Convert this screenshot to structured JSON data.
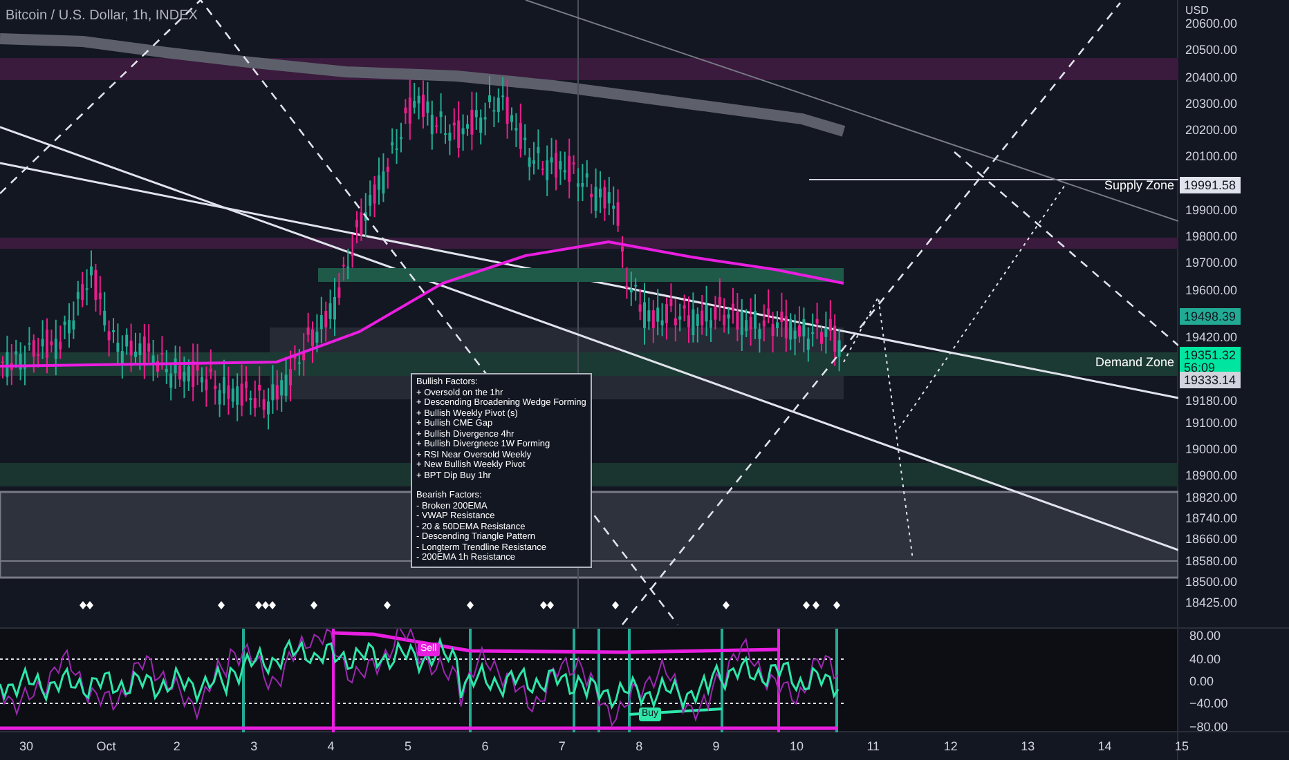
{
  "chart": {
    "title": "Bitcoin / U.S. Dollar, 1h, INDEX",
    "zones": [
      {
        "kind": "supply",
        "label": "Supply Zone"
      },
      {
        "kind": "demand",
        "label": "Demand Zone"
      }
    ],
    "note": {
      "bullish_title": "Bullish Factors:",
      "bullish": [
        "+ Oversold on the 1hr",
        "+ Descending Broadening Wedge Forming",
        "+ Bullish Weekly Pivot (s)",
        "+ Bullish CME Gap",
        "+ Bullish Divergence 4hr",
        "+ Bullish Divergnece 1W Forming",
        "+ RSI Near Oversold Weekly",
        "+ New Bullish Weekly Pivot",
        "+ BPT Dip Buy 1hr"
      ],
      "bearish_title": "Bearish Factors:",
      "bearish": [
        "- Broken 200EMA",
        "- VWAP Resistance",
        "- 20 & 50DEMA Resistance",
        "- Descending Triangle Pattern",
        "- Longterm Trendline Resistance",
        "- 200EMA 1h Resistance"
      ]
    }
  },
  "price_axis": {
    "currency": "USD",
    "labels": [
      "20600.00",
      "20500.00",
      "20400.00",
      "20300.00",
      "20200.00",
      "20100.00",
      "19900.00",
      "19800.00",
      "19700.00",
      "19600.00",
      "19420.00",
      "19180.00",
      "19100.00",
      "19000.00",
      "18900.00",
      "18820.00",
      "18740.00",
      "18660.00",
      "18580.00",
      "18500.00",
      "18425.00"
    ],
    "tags": [
      {
        "value": "19991.58",
        "color": "#e0e3eb"
      },
      {
        "value": "19498.39",
        "color": "#22ab94"
      },
      {
        "value": "19351.32",
        "countdown": "56:09",
        "color": "#00e6a0"
      },
      {
        "value": "19333.14",
        "color": "#d1d4dc"
      }
    ]
  },
  "oscillator": {
    "labels": [
      "80.00",
      "40.00",
      "0.00",
      "−40.00",
      "−80.00"
    ],
    "signals": [
      {
        "kind": "sell",
        "label": "Sell"
      },
      {
        "kind": "buy",
        "label": "Buy"
      }
    ]
  },
  "time_axis": {
    "labels": [
      "30",
      "Oct",
      "2",
      "3",
      "4",
      "5",
      "6",
      "7",
      "8",
      "9",
      "10",
      "11",
      "12",
      "13",
      "14",
      "15"
    ]
  }
}
